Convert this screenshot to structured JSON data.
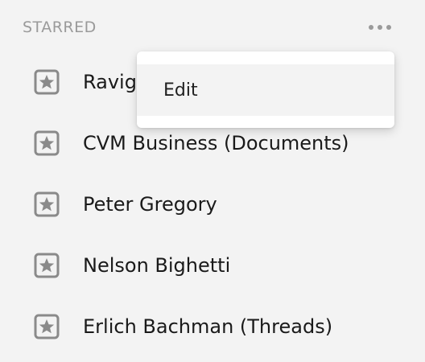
{
  "sidebar": {
    "section_title": "STARRED",
    "more_icon": "more-horizontal-icon",
    "items": [
      {
        "label": "Ravig",
        "icon": "star-icon"
      },
      {
        "label": "CVM Business (Documents)",
        "icon": "star-icon"
      },
      {
        "label": "Peter Gregory",
        "icon": "star-icon"
      },
      {
        "label": "Nelson Bighetti",
        "icon": "star-icon"
      },
      {
        "label": "Erlich Bachman (Threads)",
        "icon": "star-icon"
      }
    ]
  },
  "context_menu": {
    "items": [
      {
        "label": "Edit"
      }
    ]
  },
  "colors": {
    "background": "#f3f3f3",
    "text": "#1a1a1a",
    "muted": "#9a9a9a",
    "icon": "#8a8a8a",
    "menu_bg": "#ffffff"
  }
}
